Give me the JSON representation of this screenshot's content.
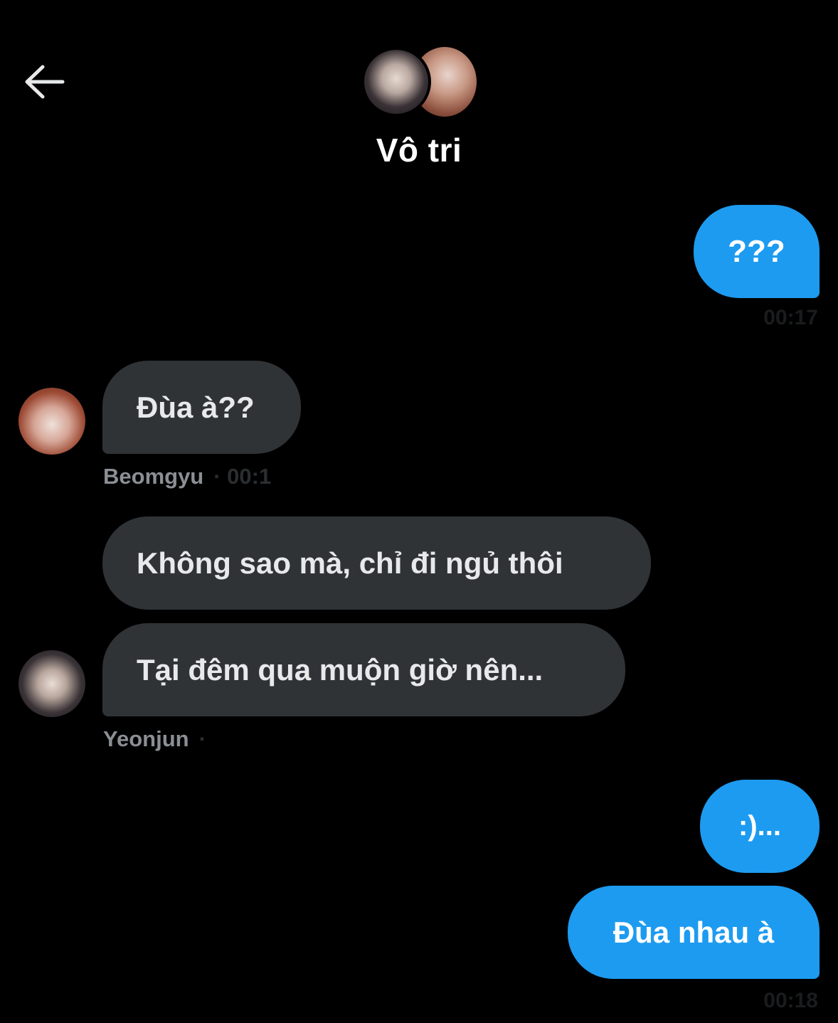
{
  "header": {
    "back_icon": "arrow-left-icon",
    "title": "Vô tri",
    "group_avatars": [
      "group-member-avatar-1",
      "group-member-avatar-2"
    ]
  },
  "colors": {
    "background": "#000000",
    "outgoing_bubble": "#1d9bf0",
    "incoming_bubble": "#2f3336",
    "sender_name": "#8b8f94"
  },
  "messages": [
    {
      "direction": "out",
      "text": "???",
      "timestamp": "00:17"
    },
    {
      "direction": "in",
      "text": "Đùa à??",
      "sender": "Beomgyu",
      "time_fragment": "· 00:1"
    },
    {
      "direction": "in",
      "text": "Không sao mà, chỉ đi ngủ thôi"
    },
    {
      "direction": "in",
      "text": "Tại đêm qua muộn giờ nên...",
      "sender": "Yeonjun",
      "time_fragment": "·"
    },
    {
      "direction": "out",
      "text": ":)..."
    },
    {
      "direction": "out",
      "text": "Đùa nhau à",
      "timestamp": "00:18"
    }
  ]
}
